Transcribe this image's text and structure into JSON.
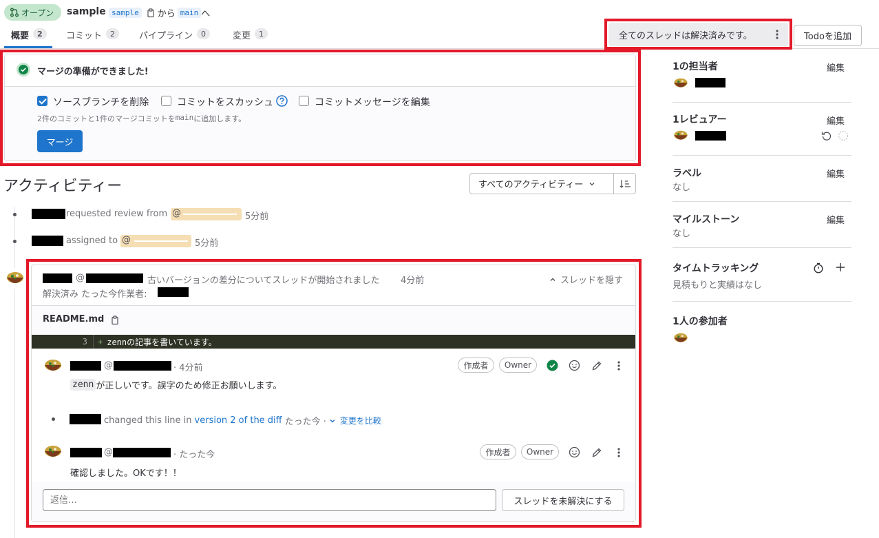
{
  "header": {
    "status": "オープン",
    "title": "sample",
    "source_branch": "sample",
    "from_text": "から",
    "target_branch": "main",
    "to_text": "へ"
  },
  "tabs": [
    {
      "label": "概要",
      "count": "2"
    },
    {
      "label": "コミット",
      "count": "2"
    },
    {
      "label": "パイプライン",
      "count": "0"
    },
    {
      "label": "変更",
      "count": "1"
    }
  ],
  "toolbar": {
    "threads_resolved": "全てのスレッドは解決済みです。",
    "add_todo": "Todoを追加"
  },
  "merge_widget": {
    "ready_text": "マージの準備ができました!",
    "option_delete_branch": "ソースブランチを削除",
    "option_squash": "コミットをスカッシュ",
    "option_edit_message": "コミットメッセージを編集",
    "summary_prefix": "2件のコミットと1件のマージコミットを",
    "summary_branch": "main",
    "summary_suffix": "に追加します。",
    "merge_button": "マージ"
  },
  "activity": {
    "heading": "アクティビティー",
    "filter": "すべてのアクティビティー",
    "events": [
      {
        "text": "requested review from",
        "at": "@",
        "time": "5分前"
      },
      {
        "text": "assigned to",
        "at": "@",
        "time": "5分前"
      }
    ]
  },
  "thread": {
    "at": "@",
    "started_text": "古いバージョンの差分についてスレッドが開始されました",
    "started_time": "4分前",
    "hide_thread": "スレッドを隠す",
    "resolved_text": "解決済み たった今作業者:",
    "file_name": "README.md",
    "diff_line_number": "3",
    "diff_marker": "+",
    "diff_line": "zennの記事を書いています。",
    "comments": [
      {
        "at": "@",
        "time": "· 4分前",
        "badge_author": "作成者",
        "badge_role": "Owner",
        "code": "zenn",
        "body": "が正しいです。誤字のため修正お願いします。"
      },
      {
        "at": "@",
        "time": "· たった今",
        "badge_author": "作成者",
        "badge_role": "Owner",
        "body": "確認しました。OKです！！"
      }
    ],
    "system_note": {
      "text": "changed this line in",
      "link": "version 2 of the diff",
      "time": "たった今 ·",
      "compare": "変更を比較"
    },
    "reply_placeholder": "返信…",
    "unresolve_button": "スレッドを未解決にする"
  },
  "sidebar": {
    "assignee": {
      "title": "1の担当者",
      "edit": "編集"
    },
    "reviewer": {
      "title": "1レビュアー",
      "edit": "編集"
    },
    "labels": {
      "title": "ラベル",
      "edit": "編集",
      "value": "なし"
    },
    "milestone": {
      "title": "マイルストーン",
      "edit": "編集",
      "value": "なし"
    },
    "time_tracking": {
      "title": "タイムトラッキング",
      "value": "見積もりと実績はなし"
    },
    "participants": {
      "title": "1人の参加者"
    }
  },
  "colors": {
    "accent": "#1f75cb",
    "success": "#108548",
    "highlight_border": "#e3192a",
    "diff_bg": "#2e3225"
  }
}
